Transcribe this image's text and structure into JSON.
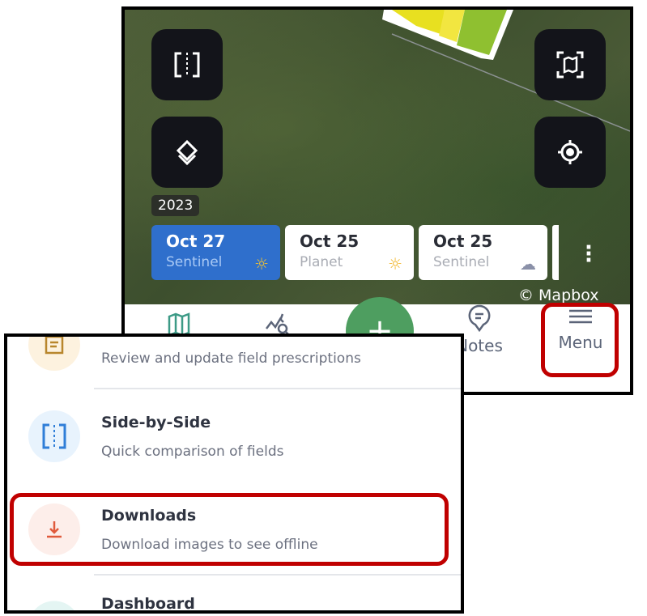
{
  "map": {
    "year": "2023",
    "attribution": "© Mapbox",
    "buttons": [
      "split-view-icon",
      "layers-icon",
      "fit-field-icon",
      "locate-icon"
    ],
    "image_dates": [
      {
        "date": "Oct 27",
        "source": "Sentinel",
        "weather": "sunny",
        "selected": true
      },
      {
        "date": "Oct 25",
        "source": "Planet",
        "weather": "sunny",
        "selected": false
      },
      {
        "date": "Oct 25",
        "source": "Sentinel",
        "weather": "cloudy",
        "selected": false
      }
    ]
  },
  "nav": {
    "items": [
      {
        "icon": "map-icon",
        "label": ""
      },
      {
        "icon": "analysis-icon",
        "label": ""
      },
      {
        "icon": "add-icon",
        "label": "+"
      },
      {
        "icon": "notes-icon",
        "label": "Notes"
      },
      {
        "icon": "menu-icon",
        "label": "Menu"
      }
    ]
  },
  "menu": {
    "items": [
      {
        "title": "",
        "subtitle": "Review and update field prescriptions",
        "icon": "prescription-icon"
      },
      {
        "title": "Side-by-Side",
        "subtitle": "Quick comparison of fields",
        "icon": "split-view-icon"
      },
      {
        "title": "Downloads",
        "subtitle": "Download images to see offline",
        "icon": "download-icon"
      },
      {
        "title": "Dashboard",
        "subtitle": "",
        "icon": "dashboard-icon"
      }
    ]
  },
  "colors": {
    "highlight": "#c00000",
    "selected_card": "#2f6fcc",
    "fab": "#4e9e60"
  }
}
